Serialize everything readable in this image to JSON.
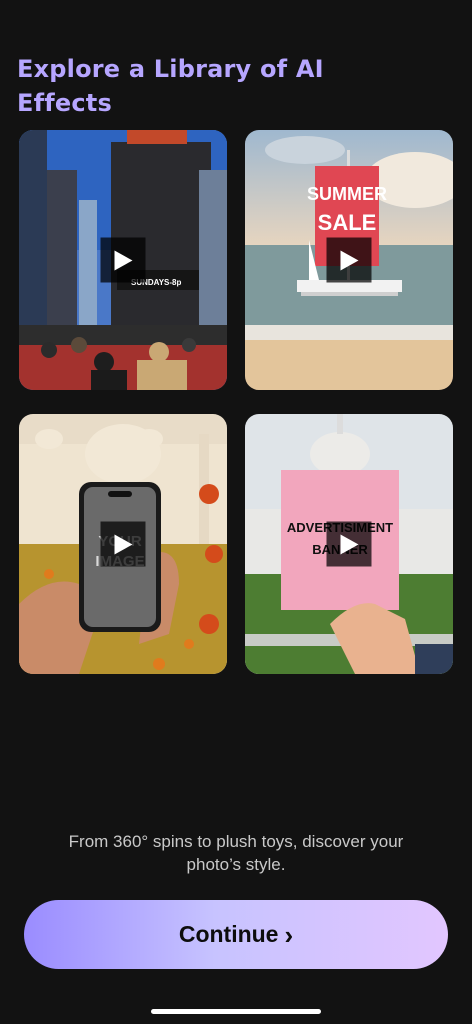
{
  "header": {
    "title": "Explore a Library of AI Effects"
  },
  "cards": [
    {
      "name": "billboard-effect",
      "sign": "SUNDAYS-8p"
    },
    {
      "name": "sail-effect",
      "sign_line1": "SUMMER",
      "sign_line2": "SALE"
    },
    {
      "name": "phone-effect",
      "overlay": "YOUR IMAGE"
    },
    {
      "name": "banner-effect",
      "overlay_line1": "ADVERTISIMENT",
      "overlay_line2": "BANNER"
    }
  ],
  "description": "From 360° spins to plush toys, discover your photo’s style.",
  "continue_button": {
    "label": "Continue",
    "icon": "chevron-right-icon"
  },
  "colors": {
    "title": "#b6a6ff",
    "background": "#121212",
    "cta_start": "#9a8cff",
    "cta_end": "#e2c6ff"
  }
}
